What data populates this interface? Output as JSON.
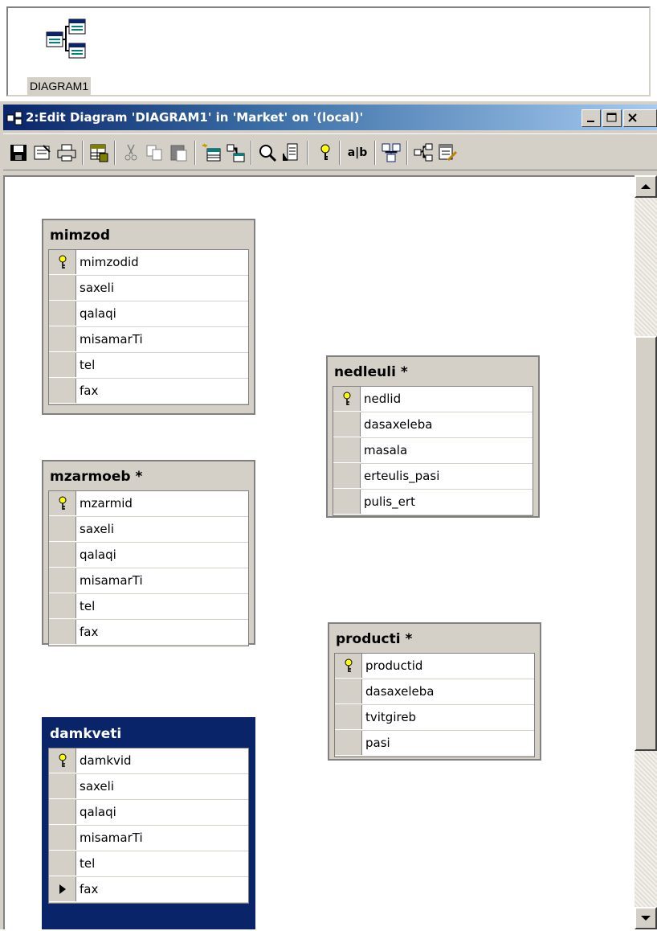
{
  "object_pane": {
    "diagram_label": "DIAGRAM1"
  },
  "window": {
    "title": "2:Edit Diagram 'DIAGRAM1' in 'Market' on '(local)'",
    "caption_buttons": [
      "minimize",
      "maximize",
      "close"
    ]
  },
  "toolbar": {
    "buttons": [
      "save-icon",
      "properties-icon",
      "print-icon",
      "table-icon",
      "cut-icon",
      "copy-icon",
      "paste-icon",
      "new-table-icon",
      "add-table-icon",
      "zoom-icon",
      "layout-icon",
      "key-icon",
      "name-icon",
      "arrange-icon",
      "relationship-icon",
      "edit-icon"
    ],
    "name_label": "a|b"
  },
  "tables": [
    {
      "name": "mimzod",
      "selected": false,
      "columns": [
        {
          "name": "mimzodid",
          "pk": true
        },
        {
          "name": "saxeli",
          "pk": false
        },
        {
          "name": "qalaqi",
          "pk": false
        },
        {
          "name": "misamarTi",
          "pk": false
        },
        {
          "name": "tel",
          "pk": false
        },
        {
          "name": "fax",
          "pk": false
        }
      ]
    },
    {
      "name": "nedleuli *",
      "selected": false,
      "columns": [
        {
          "name": "nedlid",
          "pk": true
        },
        {
          "name": "dasaxeleba",
          "pk": false
        },
        {
          "name": "masala",
          "pk": false
        },
        {
          "name": "erteulis_pasi",
          "pk": false
        },
        {
          "name": "pulis_ert",
          "pk": false
        }
      ]
    },
    {
      "name": "mzarmoeb *",
      "selected": false,
      "columns": [
        {
          "name": "mzarmid",
          "pk": true
        },
        {
          "name": "saxeli",
          "pk": false
        },
        {
          "name": "qalaqi",
          "pk": false
        },
        {
          "name": "misamarTi",
          "pk": false
        },
        {
          "name": "tel",
          "pk": false
        },
        {
          "name": "fax",
          "pk": false
        }
      ]
    },
    {
      "name": "producti *",
      "selected": false,
      "columns": [
        {
          "name": "productid",
          "pk": true
        },
        {
          "name": "dasaxeleba",
          "pk": false
        },
        {
          "name": "tvitgireb",
          "pk": false
        },
        {
          "name": "pasi",
          "pk": false
        }
      ]
    },
    {
      "name": "damkveti",
      "selected": true,
      "columns": [
        {
          "name": "damkvid",
          "pk": true
        },
        {
          "name": "saxeli",
          "pk": false
        },
        {
          "name": "qalaqi",
          "pk": false
        },
        {
          "name": "misamarTi",
          "pk": false
        },
        {
          "name": "tel",
          "pk": false
        },
        {
          "name": "fax",
          "pk": false,
          "current": true
        }
      ]
    }
  ],
  "colors": {
    "title_gradient_start": "#0a246a",
    "title_gradient_end": "#a6caf0",
    "selected_table": "#0a246a",
    "chrome": "#d4d0c8"
  }
}
